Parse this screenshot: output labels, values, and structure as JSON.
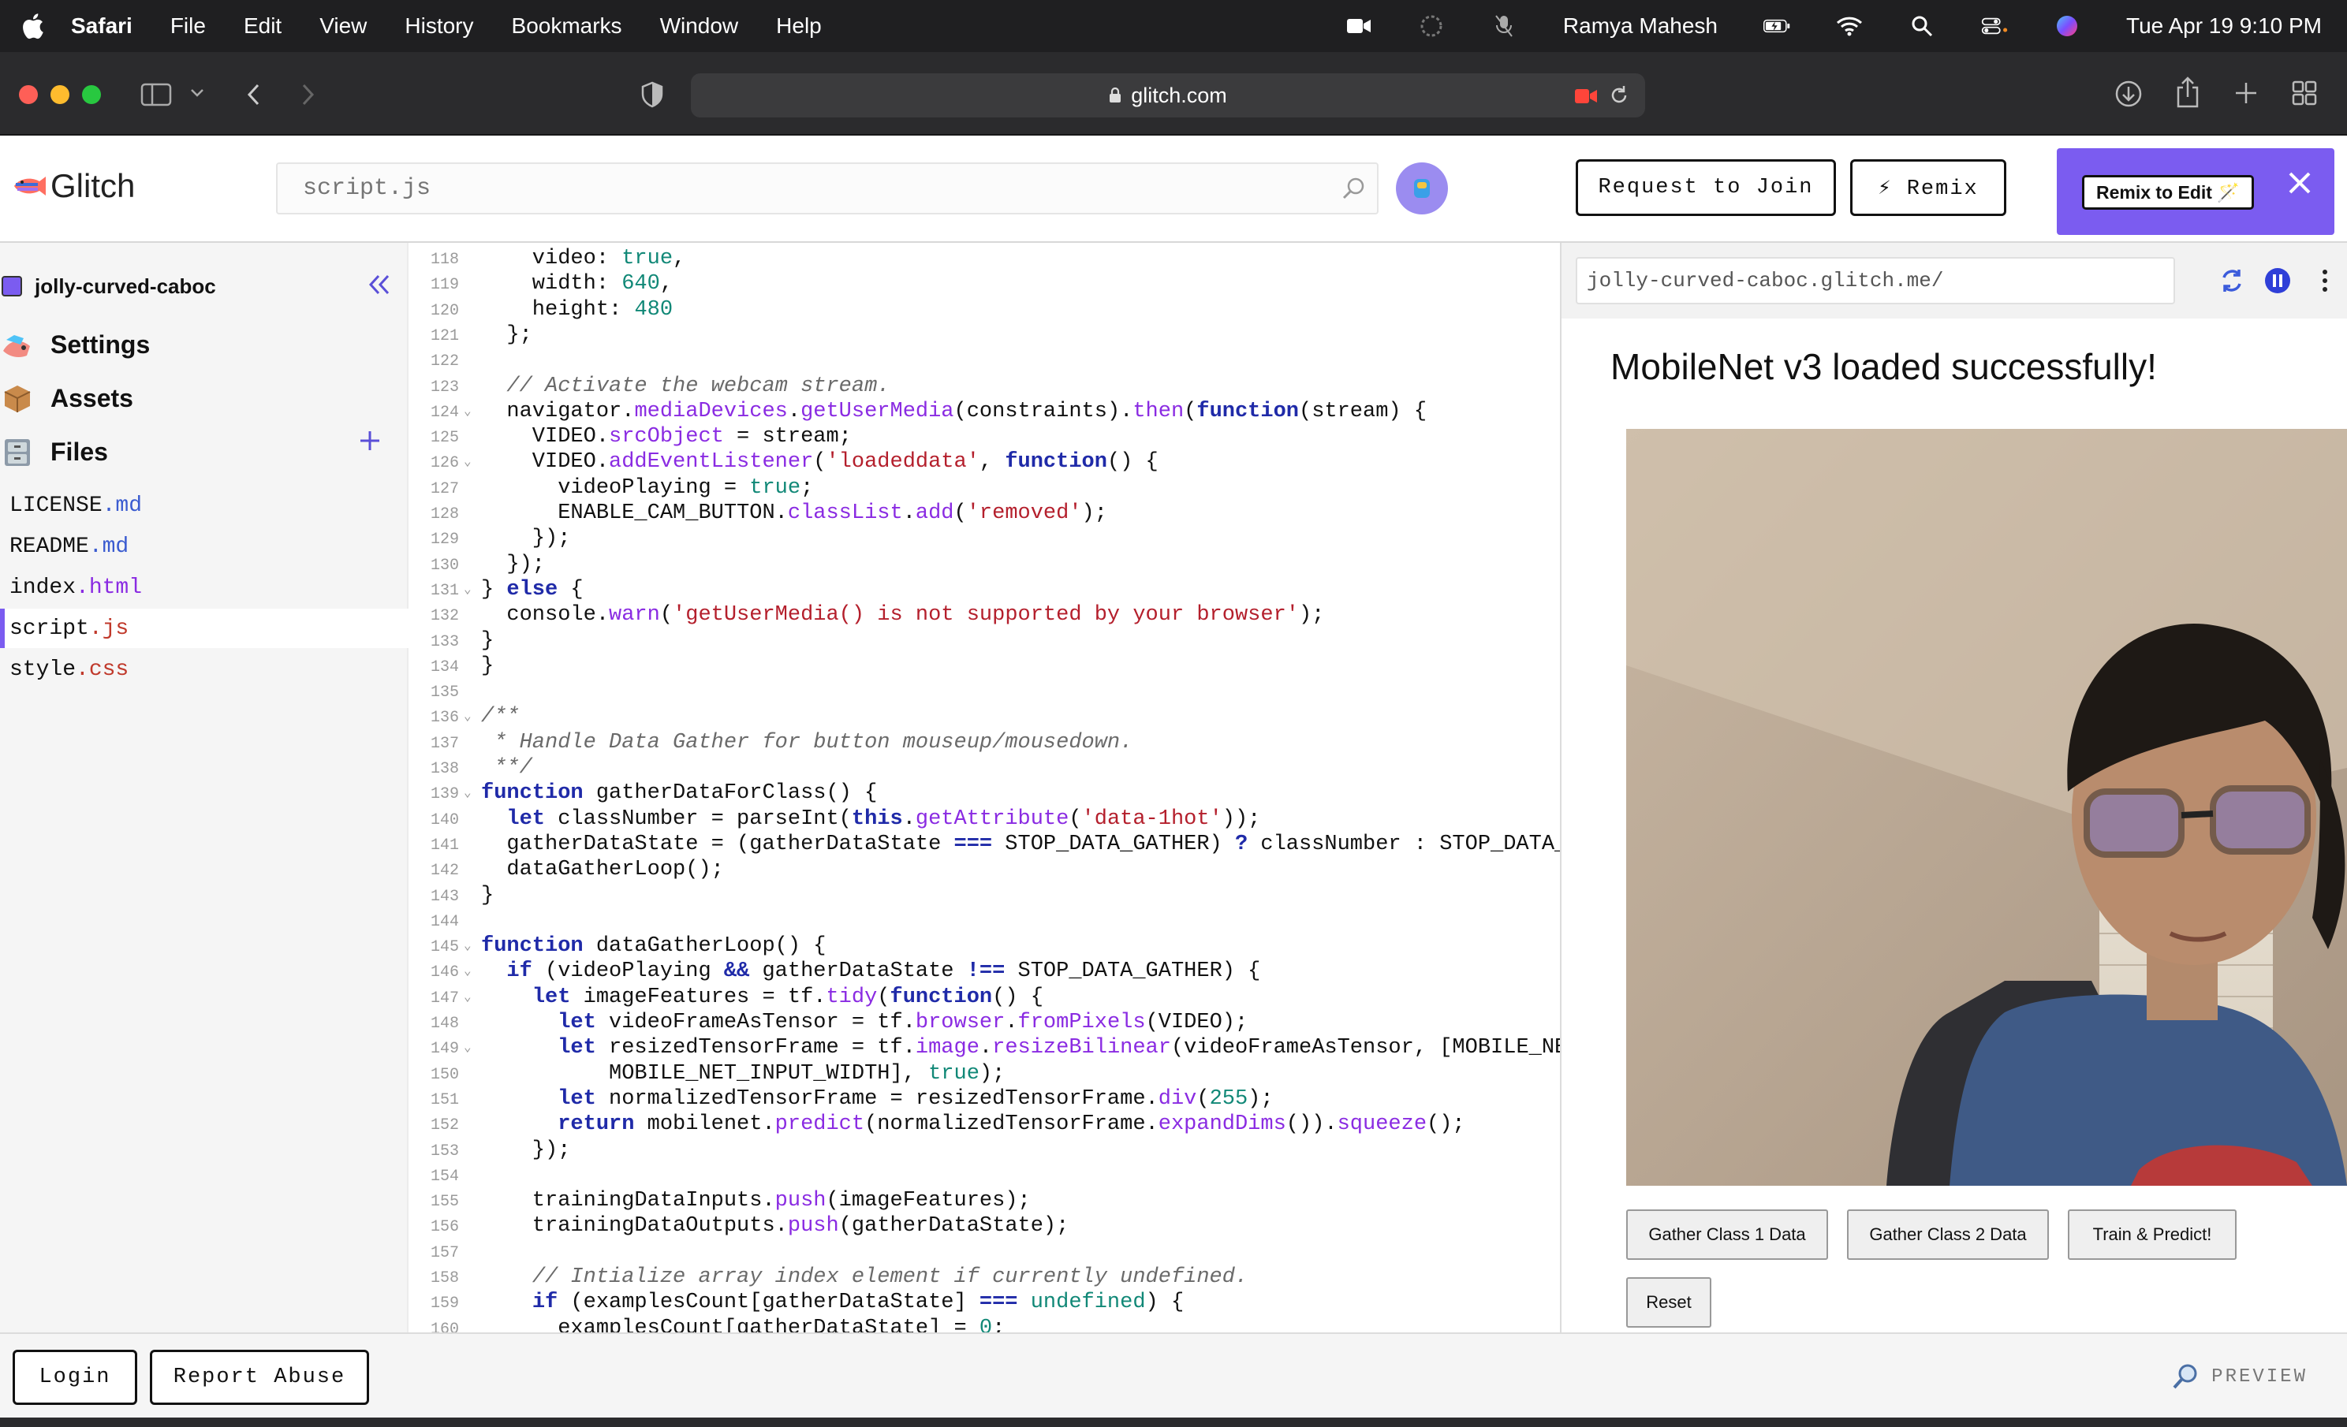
{
  "menubar": {
    "app": "Safari",
    "menus": [
      "File",
      "Edit",
      "View",
      "History",
      "Bookmarks",
      "Window",
      "Help"
    ],
    "user": "Ramya Mahesh",
    "clock": "Tue Apr 19  9:10 PM"
  },
  "browser": {
    "url": "glitch.com"
  },
  "header": {
    "logo_text": "Glitch",
    "search_placeholder": "script.js",
    "request_join": "Request to Join",
    "remix": "⚡ Remix",
    "remix_to_edit": "Remix to Edit 🪄"
  },
  "sidebar": {
    "project": "jolly-curved-caboc",
    "items": [
      "Settings",
      "Assets",
      "Files"
    ],
    "files": [
      {
        "name": "LICENSE",
        "ext": ".md"
      },
      {
        "name": "README",
        "ext": ".md"
      },
      {
        "name": "index",
        "ext": ".html"
      },
      {
        "name": "script",
        "ext": ".js"
      },
      {
        "name": "style",
        "ext": ".css"
      }
    ]
  },
  "editor": {
    "lines": [
      {
        "n": "118",
        "html": "    video: <span class=\"bool\">true</span>,"
      },
      {
        "n": "119",
        "html": "    width: <span class=\"num\">640</span>,"
      },
      {
        "n": "120",
        "html": "    height: <span class=\"num\">480</span>"
      },
      {
        "n": "121",
        "html": "  };"
      },
      {
        "n": "122",
        "html": ""
      },
      {
        "n": "123",
        "html": "  <span class=\"cmt\">// Activate the webcam stream.</span>"
      },
      {
        "n": "124",
        "fold": true,
        "html": "  navigator.<span class=\"fn\">mediaDevices</span>.<span class=\"fn\">getUserMedia</span>(constraints).<span class=\"fn\">then</span>(<span class=\"kw\">function</span>(stream) {"
      },
      {
        "n": "125",
        "html": "    VIDEO.<span class=\"fn\">srcObject</span> = stream;"
      },
      {
        "n": "126",
        "fold": true,
        "html": "    VIDEO.<span class=\"fn\">addEventListener</span>(<span class=\"str\">'loadeddata'</span>, <span class=\"kw\">function</span>() {"
      },
      {
        "n": "127",
        "html": "      videoPlaying = <span class=\"bool\">true</span>;"
      },
      {
        "n": "128",
        "html": "      ENABLE_CAM_BUTTON.<span class=\"fn\">classList</span>.<span class=\"fn\">add</span>(<span class=\"str\">'removed'</span>);"
      },
      {
        "n": "129",
        "html": "    });"
      },
      {
        "n": "130",
        "html": "  });"
      },
      {
        "n": "131",
        "fold": true,
        "html": "} <span class=\"kw\">else</span> {"
      },
      {
        "n": "132",
        "html": "  console.<span class=\"fn\">warn</span>(<span class=\"str\">'getUserMedia() is not supported by your browser'</span>);"
      },
      {
        "n": "133",
        "html": "}"
      },
      {
        "n": "134",
        "html": "}"
      },
      {
        "n": "135",
        "html": ""
      },
      {
        "n": "136",
        "fold": true,
        "html": "<span class=\"cmt\">/**</span>"
      },
      {
        "n": "137",
        "html": "<span class=\"cmt\"> * Handle Data Gather for button mouseup/mousedown.</span>"
      },
      {
        "n": "138",
        "html": "<span class=\"cmt\"> **/</span>"
      },
      {
        "n": "139",
        "fold": true,
        "html": "<span class=\"kw\">function</span> gatherDataForClass() {"
      },
      {
        "n": "140",
        "html": "  <span class=\"kw\">let</span> classNumber = parseInt(<span class=\"kw\">this</span>.<span class=\"fn\">getAttribute</span>(<span class=\"str\">'data-1hot'</span>));"
      },
      {
        "n": "141",
        "html": "  gatherDataState = (gatherDataState <span class=\"kw\">===</span> STOP_DATA_GATHER) <span class=\"kw\">?</span> classNumber : STOP_DATA_GATHER;"
      },
      {
        "n": "142",
        "html": "  dataGatherLoop();"
      },
      {
        "n": "143",
        "html": "}"
      },
      {
        "n": "144",
        "html": ""
      },
      {
        "n": "145",
        "fold": true,
        "html": "<span class=\"kw\">function</span> dataGatherLoop() {"
      },
      {
        "n": "146",
        "fold": true,
        "html": "  <span class=\"kw\">if</span> (videoPlaying <span class=\"kw\">&amp;&amp;</span> gatherDataState <span class=\"kw\">!==</span> STOP_DATA_GATHER) {"
      },
      {
        "n": "147",
        "fold": true,
        "html": "    <span class=\"kw\">let</span> imageFeatures = tf.<span class=\"fn\">tidy</span>(<span class=\"kw\">function</span>() {"
      },
      {
        "n": "148",
        "html": "      <span class=\"kw\">let</span> videoFrameAsTensor = tf.<span class=\"fn\">browser</span>.<span class=\"fn\">fromPixels</span>(VIDEO);"
      },
      {
        "n": "149",
        "fold": true,
        "html": "      <span class=\"kw\">let</span> resizedTensorFrame = tf.<span class=\"fn\">image</span>.<span class=\"fn\">resizeBilinear</span>(videoFrameAsTensor, [MOBILE_NET_INPUT_HEIGHT,"
      },
      {
        "n": "150",
        "html": "          MOBILE_NET_INPUT_WIDTH], <span class=\"bool\">true</span>);"
      },
      {
        "n": "151",
        "html": "      <span class=\"kw\">let</span> normalizedTensorFrame = resizedTensorFrame.<span class=\"fn\">div</span>(<span class=\"num\">255</span>);"
      },
      {
        "n": "152",
        "html": "      <span class=\"kw\">return</span> mobilenet.<span class=\"fn\">predict</span>(normalizedTensorFrame.<span class=\"fn\">expandDims</span>()).<span class=\"fn\">squeeze</span>();"
      },
      {
        "n": "153",
        "html": "    });"
      },
      {
        "n": "154",
        "html": ""
      },
      {
        "n": "155",
        "html": "    trainingDataInputs.<span class=\"fn\">push</span>(imageFeatures);"
      },
      {
        "n": "156",
        "html": "    trainingDataOutputs.<span class=\"fn\">push</span>(gatherDataState);"
      },
      {
        "n": "157",
        "html": ""
      },
      {
        "n": "158",
        "html": "    <span class=\"cmt\">// Intialize array index element if currently undefined.</span>"
      },
      {
        "n": "159",
        "html": "    <span class=\"kw\">if</span> (examplesCount[gatherDataState] <span class=\"kw\">===</span> <span class=\"bool\">undefined</span>) {"
      },
      {
        "n": "160",
        "html": "      examplesCount[gatherDataState] = <span class=\"num\">0</span>;"
      }
    ]
  },
  "preview": {
    "url": "jolly-curved-caboc.glitch.me/",
    "title": "MobileNet v3 loaded successfully!",
    "buttons": [
      "Gather Class 1 Data",
      "Gather Class 2 Data",
      "Train & Predict!",
      "Reset"
    ]
  },
  "bottom": {
    "login": "Login",
    "report": "Report Abuse",
    "preview": "PREVIEW"
  }
}
